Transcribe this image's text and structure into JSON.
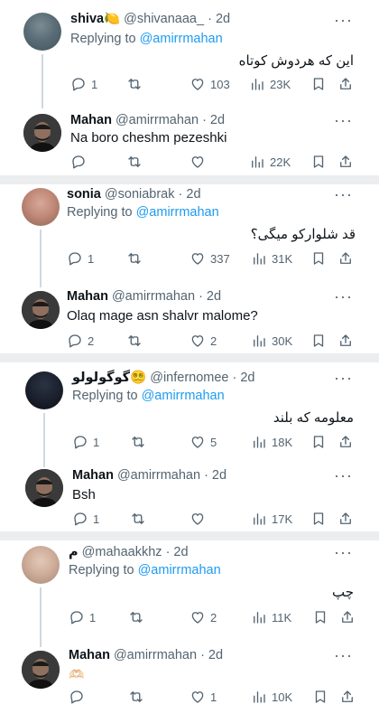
{
  "threads": [
    {
      "reply": {
        "name": "shiva🍋",
        "handle": "@shivanaaa_",
        "time": "· 2d",
        "replying_prefix": "Replying to",
        "replying_to": "@amirrmahan",
        "text": "این که هردوش کوتاه",
        "rtl": true,
        "stats": {
          "replies": "1",
          "retweets": "",
          "likes": "103",
          "views": "23K"
        },
        "avatar": "blurred-avatar"
      },
      "response": {
        "name": "Mahan",
        "handle": "@amirrmahan",
        "time": "· 2d",
        "text": "Na boro cheshm pezeshki",
        "stats": {
          "replies": "",
          "retweets": "",
          "likes": "",
          "views": "22K"
        },
        "avatar": "bearded-man-avatar"
      }
    },
    {
      "reply": {
        "name": "sonia",
        "handle": "@soniabrak",
        "time": "· 2d",
        "replying_prefix": "Replying to",
        "replying_to": "@amirrmahan",
        "text": "قد شلوارکو میگی؟",
        "rtl": true,
        "stats": {
          "replies": "1",
          "retweets": "",
          "likes": "337",
          "views": "31K"
        },
        "avatar": "blurred-avatar"
      },
      "response": {
        "name": "Mahan",
        "handle": "@amirrmahan",
        "time": "· 2d",
        "text": "Olaq mage asn shalvr malome?",
        "stats": {
          "replies": "2",
          "retweets": "",
          "likes": "2",
          "views": "30K"
        },
        "avatar": "bearded-man-avatar"
      }
    },
    {
      "reply": {
        "name": "گوگولولو😵‍💫",
        "handle": "@infernomee",
        "time": "· 2d",
        "replying_prefix": "Replying to",
        "replying_to": "@amirrmahan",
        "text": "معلومه که بلند",
        "rtl": true,
        "stats": {
          "replies": "1",
          "retweets": "",
          "likes": "5",
          "views": "18K"
        },
        "avatar": "dark-avatar"
      },
      "response": {
        "name": "Mahan",
        "handle": "@amirrmahan",
        "time": "· 2d",
        "text": "Bsh",
        "stats": {
          "replies": "1",
          "retweets": "",
          "likes": "",
          "views": "17K"
        },
        "avatar": "bearded-man-avatar"
      }
    },
    {
      "reply": {
        "name": "م",
        "handle": "@mahaakkhz",
        "time": "· 2d",
        "replying_prefix": "Replying to",
        "replying_to": "@amirrmahan",
        "text": "چپ",
        "rtl": true,
        "stats": {
          "replies": "1",
          "retweets": "",
          "likes": "2",
          "views": "11K"
        },
        "avatar": "blurred-avatar"
      },
      "response": {
        "name": "Mahan",
        "handle": "@amirrmahan",
        "time": "· 2d",
        "text": "🫶🏻",
        "stats": {
          "replies": "",
          "retweets": "",
          "likes": "1",
          "views": "10K"
        },
        "avatar": "bearded-man-avatar"
      }
    }
  ],
  "icons": {
    "reply": "reply-icon",
    "retweet": "retweet-icon",
    "like": "like-icon",
    "views": "views-icon",
    "bookmark": "bookmark-icon",
    "share": "share-icon",
    "more": "more-icon"
  },
  "colors": {
    "link": "#1d9bf0",
    "muted": "#536471",
    "text": "#0f1419",
    "separator": "#ebedef",
    "thread_line": "#cfd9de"
  },
  "more_glyph": "···"
}
